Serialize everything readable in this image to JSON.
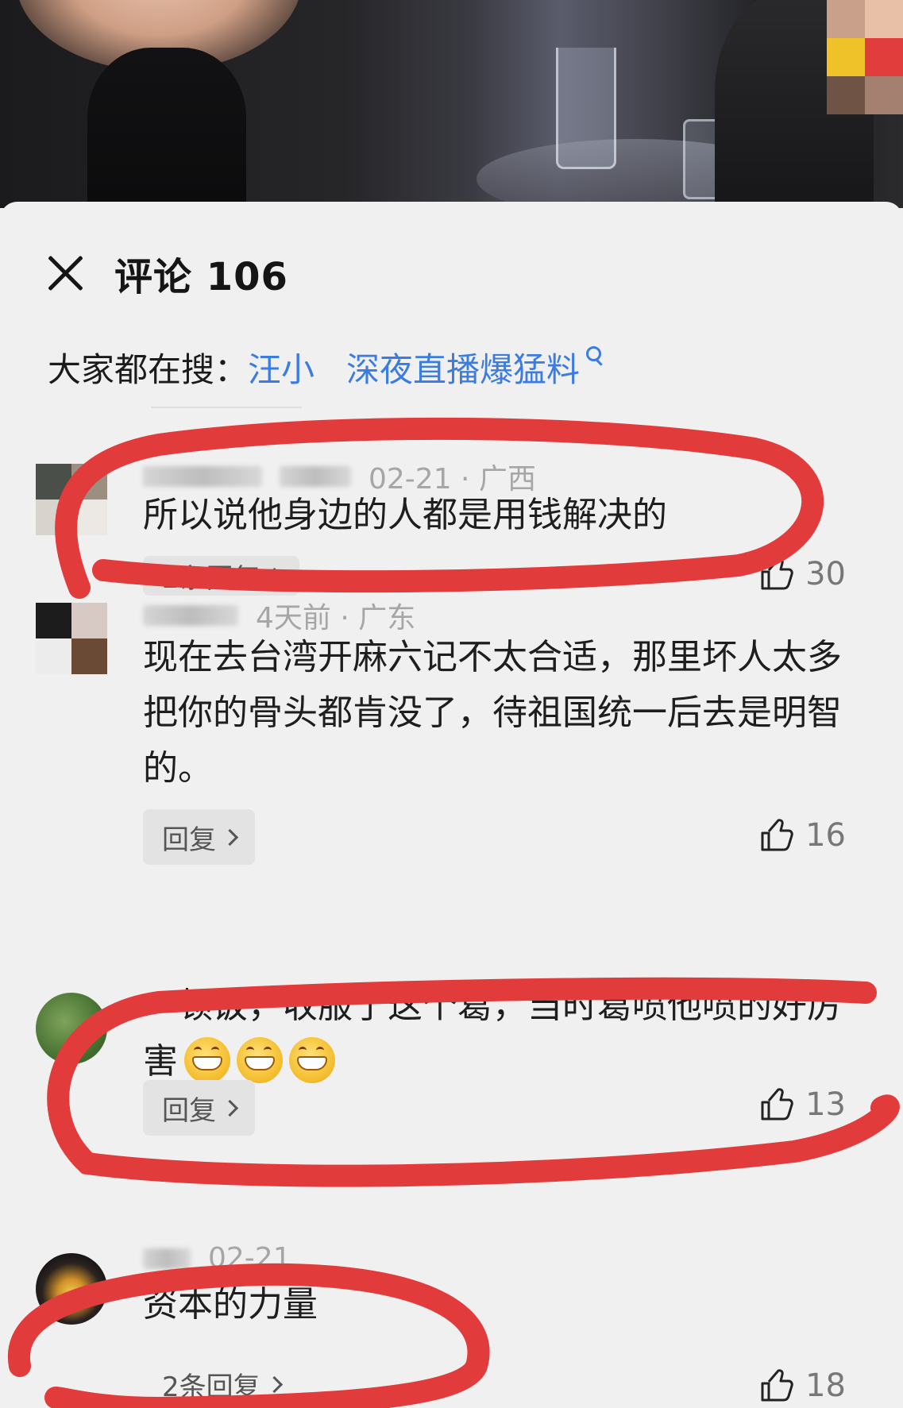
{
  "header": {
    "title": "评论 106"
  },
  "search": {
    "prefix": "大家都在搜：",
    "link_text": "汪小",
    "link_text_tail": "深夜直播爆猛料"
  },
  "comments": [
    {
      "meta": "02-21 · 广西",
      "text_lines": [
        "所以说他身边的人都是用钱解决的"
      ],
      "reply_label": "2条回复",
      "likes": "30"
    },
    {
      "meta": "4天前 · 广东",
      "text_lines": [
        "现在去台湾开麻六记不太合适，那里坏人太多",
        "把你的骨头都肯没了，待祖国统一后去是明智",
        "的。"
      ],
      "reply_label": "回复",
      "likes": "16"
    },
    {
      "meta": "",
      "text_lines": [
        "一顿饭，收服了这个葛，当时葛喷他喷的好厉",
        "害"
      ],
      "reply_label": "回复",
      "likes": "13"
    },
    {
      "meta": "02-21",
      "text_lines": [
        "资本的力量"
      ],
      "reply_label": "2条回复",
      "likes": "18"
    }
  ],
  "colors": {
    "link": "#3a7ce0",
    "annotation_red": "#e23b3b",
    "sheet_bg": "#f0f0f0"
  },
  "icons": [
    "close-icon",
    "search-icon",
    "thumb-up-icon",
    "chevron-right-icon",
    "grinning-emoji-icon"
  ]
}
